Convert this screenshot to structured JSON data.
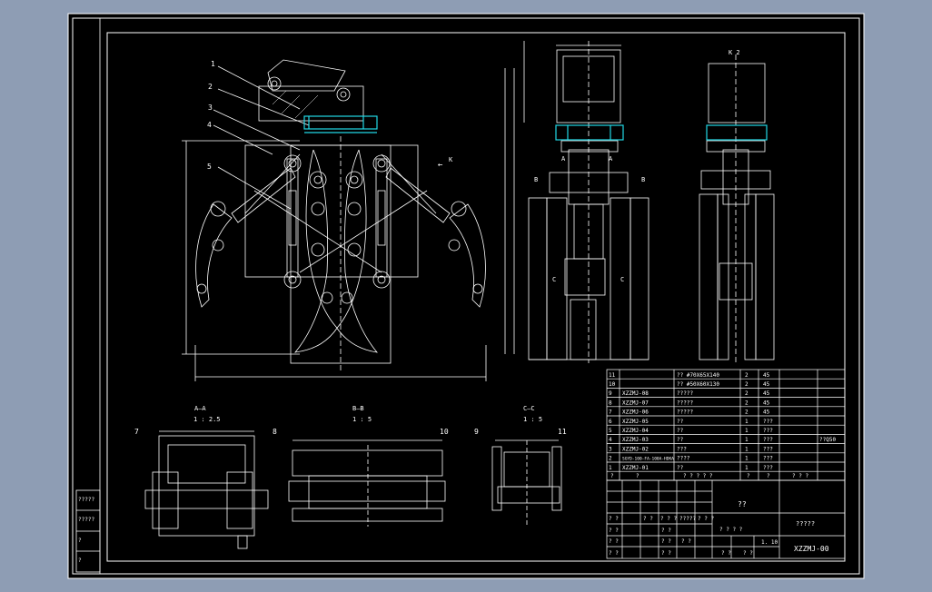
{
  "colors": {
    "frame_bg": "#8e9db4",
    "sheet": "#000000",
    "line": "#ffffff",
    "accent": "#22d8e6",
    "dim": "#dddddd"
  },
  "main_view": {
    "part_numbers": [
      "1",
      "2",
      "3",
      "4",
      "5"
    ],
    "direction_label": "K",
    "direction_arrow": "←"
  },
  "side_view": {
    "section_marks": [
      "A",
      "A",
      "B",
      "B",
      "C",
      "C"
    ]
  },
  "k_view": {
    "label": "K 2"
  },
  "sections": [
    {
      "title": "A—A",
      "scale": "1 : 2.5",
      "part_numbers": [
        "7"
      ]
    },
    {
      "title": "B—B",
      "scale": "1 : 5",
      "part_numbers": [
        "8",
        "10"
      ]
    },
    {
      "title": "C—C",
      "scale": "1 : 5",
      "part_numbers": [
        "9",
        "11"
      ]
    }
  ],
  "bom": [
    {
      "no": "11",
      "code": "",
      "name": "?? #70X65X140",
      "qty": "2",
      "mat": "45",
      "note": ""
    },
    {
      "no": "10",
      "code": "",
      "name": "?? #50X60X130",
      "qty": "2",
      "mat": "45",
      "note": ""
    },
    {
      "no": "9",
      "code": "XZZMJ-08",
      "name": "?????",
      "qty": "2",
      "mat": "45",
      "note": ""
    },
    {
      "no": "8",
      "code": "XZZMJ-07",
      "name": "?????",
      "qty": "2",
      "mat": "45",
      "note": ""
    },
    {
      "no": "7",
      "code": "XZZMJ-06",
      "name": "?????",
      "qty": "2",
      "mat": "45",
      "note": ""
    },
    {
      "no": "6",
      "code": "XZZMJ-05",
      "name": "??",
      "qty": "1",
      "mat": "???",
      "note": ""
    },
    {
      "no": "5",
      "code": "XZZMJ-04",
      "name": "??",
      "qty": "1",
      "mat": "???",
      "note": ""
    },
    {
      "no": "4",
      "code": "XZZMJ-03",
      "name": "??",
      "qty": "1",
      "mat": "???",
      "note": "??Q50"
    },
    {
      "no": "3",
      "code": "XZZMJ-02",
      "name": "???",
      "qty": "1",
      "mat": "???",
      "note": ""
    },
    {
      "no": "2",
      "code": "SGYD-100-FA-100A-HDKA",
      "name": "????",
      "qty": "1",
      "mat": "???",
      "note": ""
    },
    {
      "no": "1",
      "code": "XZZMJ-01",
      "name": "??",
      "qty": "1",
      "mat": "???",
      "note": ""
    }
  ],
  "bom_header": [
    "?",
    "?",
    "? ? ? ? ?",
    "?",
    "?",
    "?",
    "? ? ?"
  ],
  "title_block": {
    "drawing_name": "??",
    "unit_name": "?????",
    "scale": "1. 10",
    "drawing_no": "XZZMJ-00",
    "grid_labels": [
      "? ?",
      "? ?",
      "? ? ?",
      "?????",
      "? ? ?",
      "? ?",
      "? ?",
      "? ?",
      "? ?",
      "? ?",
      "? ?",
      "? ? ? ?",
      "? ?",
      "? ?",
      "? ?"
    ]
  },
  "left_strip": [
    "?????",
    "?????",
    "?",
    "?"
  ]
}
